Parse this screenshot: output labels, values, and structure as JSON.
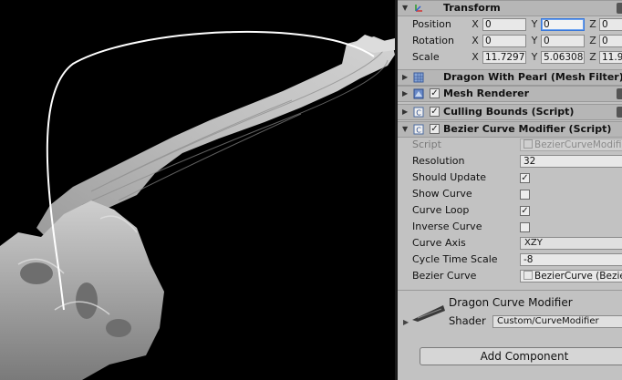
{
  "transform": {
    "title": "Transform",
    "position": {
      "label": "Position",
      "x": "0",
      "y": "0",
      "z": "0"
    },
    "rotation": {
      "label": "Rotation",
      "x": "0",
      "y": "0",
      "z": "0"
    },
    "scale": {
      "label": "Scale",
      "x": "11.7297",
      "y": "5.06308",
      "z": "11.9"
    },
    "axis_x": "X",
    "axis_y": "Y",
    "axis_z": "Z"
  },
  "components": {
    "mesh_filter": "Dragon With Pearl (Mesh Filter)",
    "mesh_renderer": "Mesh Renderer",
    "culling_bounds": "Culling Bounds (Script)",
    "bezier_modifier": "Bezier Curve Modifier (Script)"
  },
  "bezier": {
    "script_label": "Script",
    "script_value": "BezierCurveModifier",
    "resolution_label": "Resolution",
    "resolution_value": "32",
    "should_update_label": "Should Update",
    "should_update": true,
    "show_curve_label": "Show Curve",
    "show_curve": false,
    "curve_loop_label": "Curve Loop",
    "curve_loop": true,
    "inverse_curve_label": "Inverse Curve",
    "inverse_curve": false,
    "curve_axis_label": "Curve Axis",
    "curve_axis_value": "XZY",
    "cycle_time_label": "Cycle Time Scale",
    "cycle_time_value": "-8",
    "bezier_curve_label": "Bezier Curve",
    "bezier_curve_value": "BezierCurve (Bezier"
  },
  "material": {
    "name": "Dragon Curve Modifier",
    "shader_label": "Shader",
    "shader_value": "Custom/CurveModifier"
  },
  "add_component_label": "Add Component",
  "check_glyph": "✓",
  "colors": {
    "inspector_bg": "#c2c2c2",
    "accent_focus": "#3a78d8"
  }
}
